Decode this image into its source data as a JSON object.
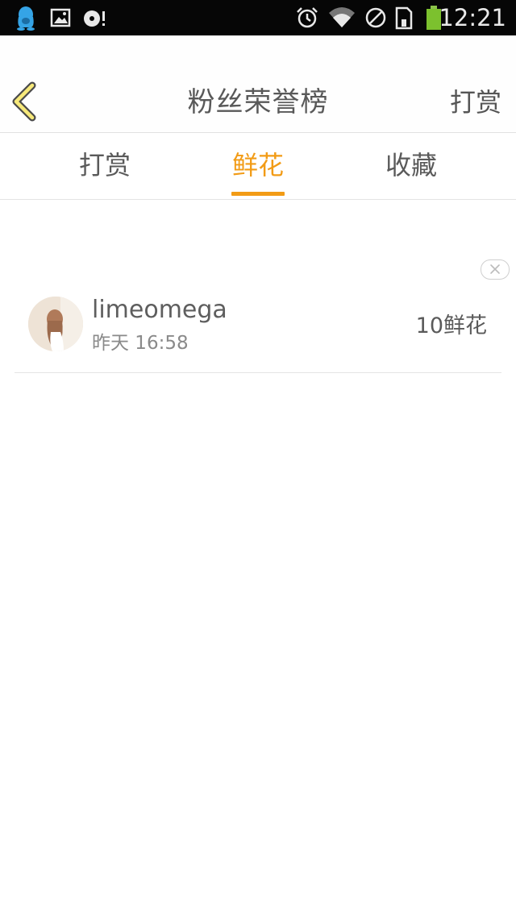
{
  "status_bar": {
    "time": "12:21",
    "left_icons": [
      "qq-icon",
      "image-icon",
      "music-sync-icon"
    ],
    "right_icons": [
      "alarm-icon",
      "wifi-icon",
      "no-sim-icon",
      "sd-card-icon",
      "battery-icon"
    ]
  },
  "header": {
    "title": "粉丝荣誉榜",
    "back_icon": "chevron-left-icon",
    "action_label": "打赏",
    "accent_color": "#f29b15"
  },
  "tabs": [
    {
      "label": "打赏",
      "active": false
    },
    {
      "label": "鲜花",
      "active": true
    },
    {
      "label": "收藏",
      "active": false
    }
  ],
  "list": {
    "close_icon": "close-icon",
    "items": [
      {
        "username": "limeomega",
        "time": "昨天 16:58",
        "amount": "10鲜花"
      }
    ]
  }
}
